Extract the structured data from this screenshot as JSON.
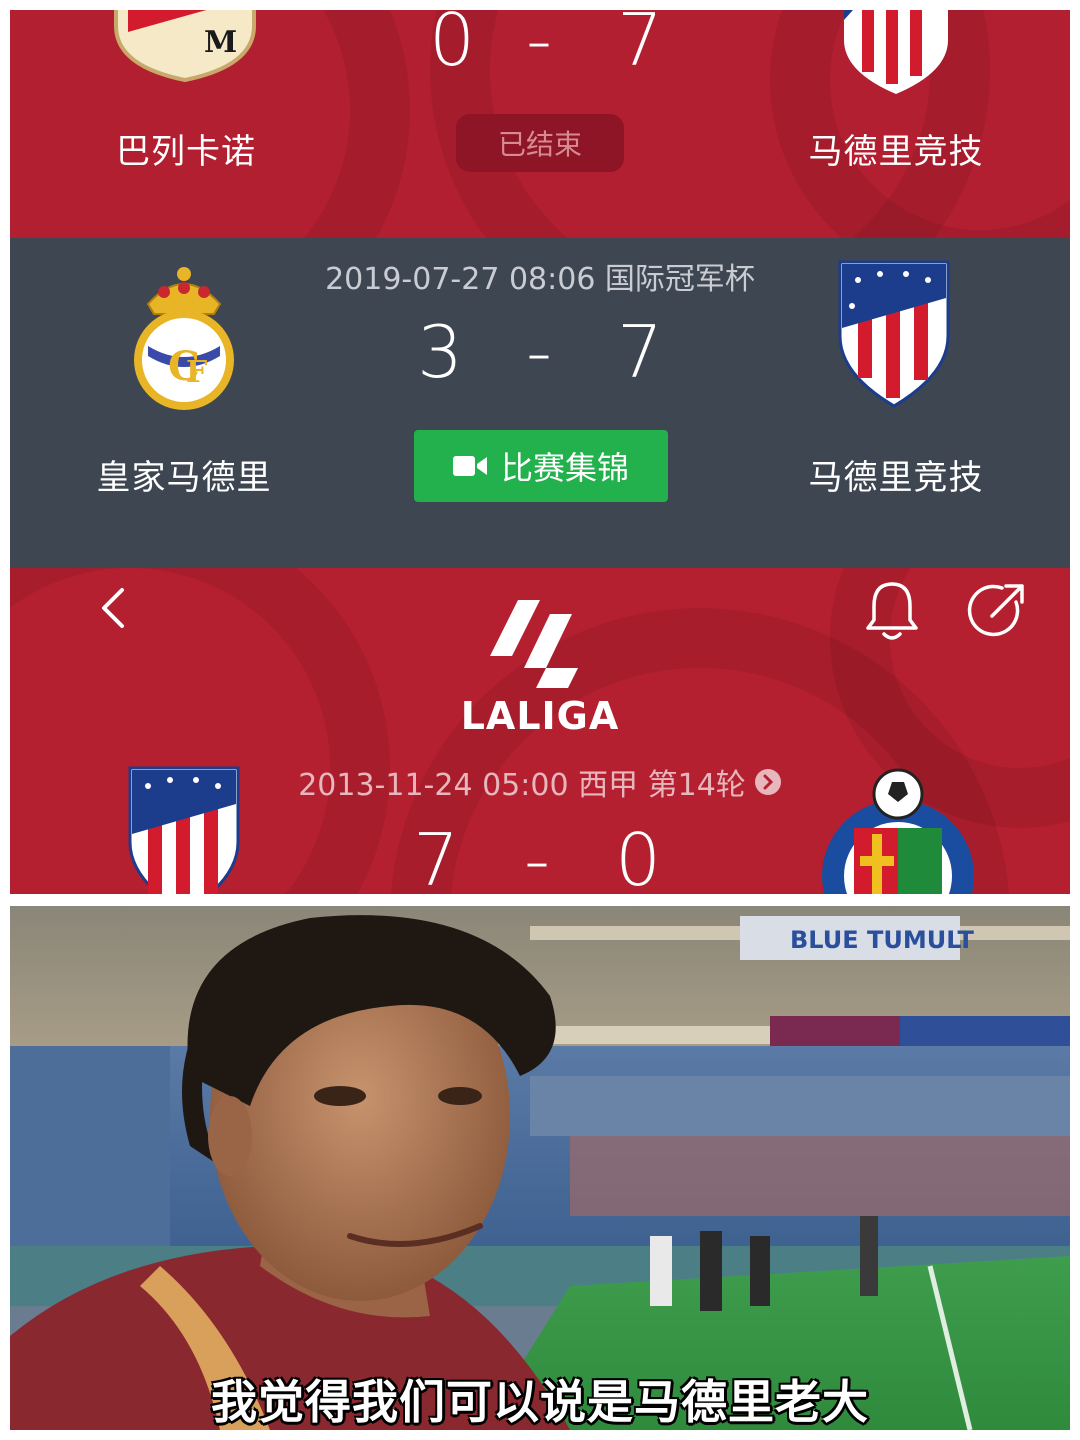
{
  "match_finished": {
    "home_team": "巴列卡诺",
    "away_team": "马德里竞技",
    "home_score": "0",
    "away_score": "7",
    "separator": "-",
    "status": "已结束"
  },
  "match_friendly": {
    "meta": "2019-07-27 08:06 国际冠军杯",
    "home_team": "皇家马德里",
    "away_team": "马德里竞技",
    "home_score": "3",
    "away_score": "7",
    "separator": "-",
    "highlights_label": "比赛集锦"
  },
  "match_league": {
    "league_logo_text": "LALIGA",
    "meta": "2013-11-24 05:00 西甲 第14轮",
    "home_score": "7",
    "away_score": "0",
    "separator": "-"
  },
  "photo": {
    "subtitle": "我觉得我们可以说是马德里老大",
    "banner_text": "BLUE TUMULT"
  },
  "colors": {
    "red_card": "#b21f30",
    "dark_card": "#3e4652",
    "highlight_green": "#22b14c"
  },
  "icons": [
    "back-icon",
    "bell-icon",
    "share-icon",
    "video-camera-icon",
    "chevron-right-icon"
  ]
}
